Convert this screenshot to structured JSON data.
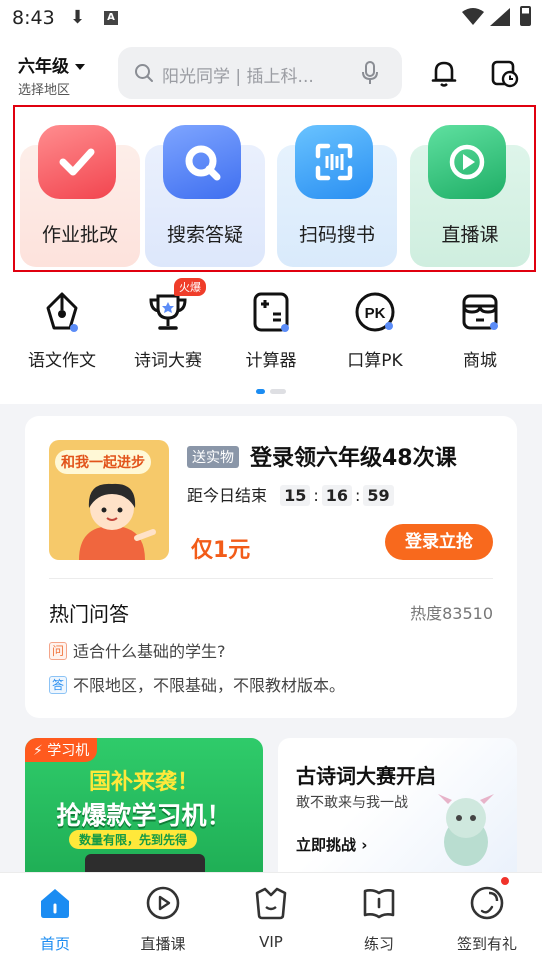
{
  "status_bar": {
    "time": "8:43",
    "a_badge": "A"
  },
  "header": {
    "grade": "六年级",
    "region": "选择地区",
    "search_placeholder": "阳光同学 | 插上科..."
  },
  "features": [
    {
      "label": "作业批改",
      "icon": "check-icon",
      "color": "#f2545a",
      "bg": "#fde9e6"
    },
    {
      "label": "搜索答疑",
      "icon": "magnifier-icon",
      "color": "#4d7ef5",
      "bg": "#e6eefc"
    },
    {
      "label": "扫码搜书",
      "icon": "scan-icon",
      "color": "#3aa0f7",
      "bg": "#e3f0fc"
    },
    {
      "label": "直播课",
      "icon": "play-icon",
      "color": "#28c07a",
      "bg": "#ddf5ea"
    }
  ],
  "mini_tools": [
    {
      "label": "语文作文",
      "icon": "pen-nib-icon"
    },
    {
      "label": "诗词大赛",
      "icon": "trophy-icon"
    },
    {
      "label": "计算器",
      "icon": "calculator-icon"
    },
    {
      "label": "口算PK",
      "icon": "pk-icon"
    },
    {
      "label": "商城",
      "icon": "shop-icon"
    }
  ],
  "hot_badge": "火爆",
  "promo": {
    "image_banner": "和我一起进步",
    "tag": "送实物",
    "title": "登录领六年级48次课",
    "countdown_label": "距今日结束",
    "countdown": [
      "15",
      "16",
      "59"
    ],
    "sep": ":",
    "price": "仅1元",
    "button": "登录立抢"
  },
  "hot_qa": {
    "title": "热门问答",
    "heat": "热度83510",
    "q_badge": "问",
    "question": "适合什么基础的学生?",
    "a_badge": "答",
    "answer": "不限地区，不限基础，不限教材版本。"
  },
  "banner_left": {
    "tag": "学习机",
    "line1": "国补来袭！",
    "line2": "抢爆款学习机！",
    "line3": "数量有限，先到先得"
  },
  "banner_right": {
    "title": "古诗词大赛开启",
    "subtitle": "敢不敢来与我一战",
    "cta": "立即挑战"
  },
  "tabs": [
    {
      "label": "首页",
      "icon": "home-icon",
      "active": true
    },
    {
      "label": "直播课",
      "icon": "live-icon",
      "active": false
    },
    {
      "label": "VIP",
      "icon": "vip-icon",
      "active": false
    },
    {
      "label": "练习",
      "icon": "book-icon",
      "active": false
    },
    {
      "label": "签到有礼",
      "icon": "gift-icon",
      "active": false
    }
  ],
  "colors": {
    "accent": "#1b8cf2",
    "orange": "#f8691d",
    "highlight_border": "#e0000f"
  }
}
